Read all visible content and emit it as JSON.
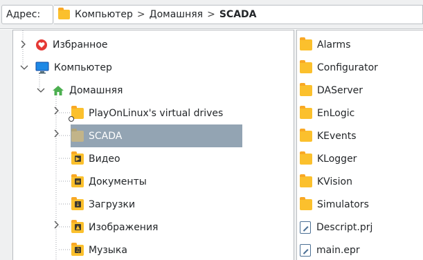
{
  "address": {
    "label": "Адрес:",
    "crumbs": [
      "Компьютер",
      "Домашняя",
      "SCADA"
    ],
    "separator": ">"
  },
  "tree": {
    "items": [
      {
        "label": "Избранное",
        "icon": "heart-icon"
      },
      {
        "label": "Компьютер",
        "icon": "monitor-icon"
      },
      {
        "label": "Домашняя",
        "icon": "home-icon"
      },
      {
        "label": "PlayOnLinux's virtual drives",
        "icon": "folder-link-icon"
      },
      {
        "label": "SCADA",
        "icon": "folder-icon",
        "selected": true
      },
      {
        "label": "Видео",
        "icon": "video-folder-icon"
      },
      {
        "label": "Документы",
        "icon": "documents-folder-icon"
      },
      {
        "label": "Загрузки",
        "icon": "downloads-folder-icon"
      },
      {
        "label": "Изображения",
        "icon": "pictures-folder-icon"
      },
      {
        "label": "Музыка",
        "icon": "music-folder-icon"
      }
    ]
  },
  "files": {
    "items": [
      {
        "label": "Alarms",
        "icon": "folder-icon"
      },
      {
        "label": "Configurator",
        "icon": "folder-icon"
      },
      {
        "label": "DAServer",
        "icon": "folder-icon"
      },
      {
        "label": "EnLogic",
        "icon": "folder-icon"
      },
      {
        "label": "KEvents",
        "icon": "folder-icon"
      },
      {
        "label": "KLogger",
        "icon": "folder-icon"
      },
      {
        "label": "KVision",
        "icon": "folder-icon"
      },
      {
        "label": "Simulators",
        "icon": "folder-icon"
      },
      {
        "label": "Descript.prj",
        "icon": "text-file-icon"
      },
      {
        "label": "main.epr",
        "icon": "text-file-icon"
      }
    ]
  },
  "colors": {
    "selection": "#93a4b3",
    "folder": "#fbc02d",
    "accent": "#3daee9"
  }
}
